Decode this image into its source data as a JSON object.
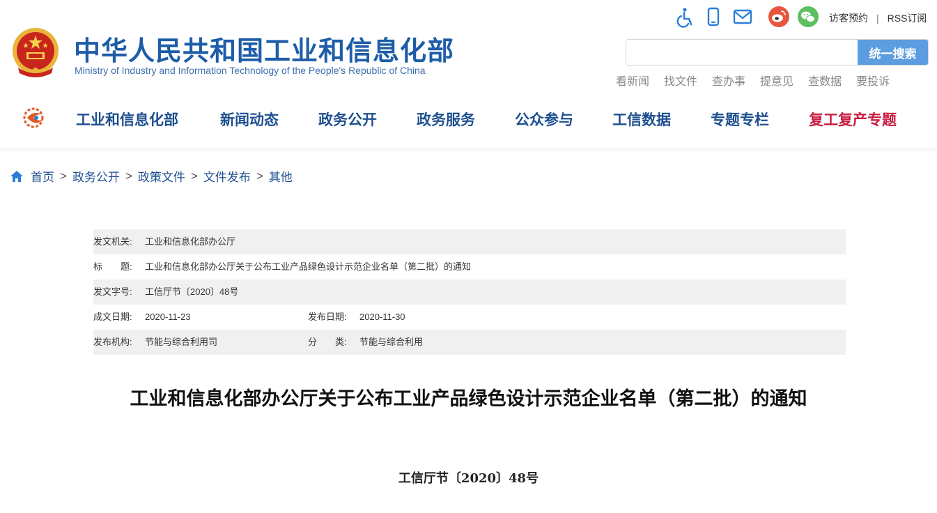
{
  "header": {
    "title": "中华人民共和国工业和信息化部",
    "subtitle": "Ministry of Industry and Information Technology of the People's Republic of China",
    "util_links": [
      "访客预约",
      "RSS订阅"
    ],
    "util_separator": "|",
    "icons": [
      "accessibility-icon",
      "mobile-icon",
      "mail-icon",
      "weibo-icon",
      "wechat-icon"
    ],
    "search": {
      "placeholder": "",
      "value": "",
      "button_label": "统一搜索"
    },
    "quick_links": [
      "看新闻",
      "找文件",
      "查办事",
      "提意见",
      "查数据",
      "要投诉"
    ]
  },
  "nav": {
    "items": [
      "工业和信息化部",
      "新闻动态",
      "政务公开",
      "政务服务",
      "公众参与",
      "工信数据",
      "专题专栏",
      "复工复产专题"
    ]
  },
  "breadcrumb": {
    "items": [
      "首页",
      "政务公开",
      "政策文件",
      "文件发布",
      "其他"
    ],
    "separator": ">"
  },
  "info": {
    "issuer_label": "发文机关:",
    "issuer": "工业和信息化部办公厅",
    "title_label": "标　　题:",
    "title": "工业和信息化部办公厅关于公布工业产品绿色设计示范企业名单（第二批）的通知",
    "doc_no_label": "发文字号:",
    "doc_no": "工信厅节〔2020〕48号",
    "written_label": "成文日期:",
    "written": "2020-11-23",
    "published_label": "发布日期:",
    "published": "2020-11-30",
    "org_label": "发布机构:",
    "org": "节能与综合利用司",
    "category_label": "分　　类:",
    "category": "节能与综合利用"
  },
  "document": {
    "title": "工业和信息化部办公厅关于公布工业产品绿色设计示范企业名单（第二批）的通知",
    "number": "工信厅节〔2020〕48号"
  },
  "colors": {
    "brand_blue": "#1d5da8",
    "nav_blue": "#1d4f8f",
    "special_red": "#c91b3e",
    "search_button": "#5b9de0",
    "row_shade": "#f0f0f0"
  }
}
